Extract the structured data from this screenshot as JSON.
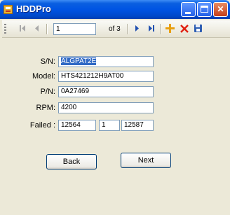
{
  "window": {
    "title": "HDDPro",
    "controls": {
      "minimize": "minimize",
      "maximize": "maximize",
      "close": "✕"
    }
  },
  "navigator": {
    "first_icon": "move-first-icon",
    "prev_icon": "move-previous-icon",
    "position": "1",
    "count_label": "of 3",
    "next_icon": "move-next-icon",
    "last_icon": "move-last-icon",
    "add_icon": "add-new-icon",
    "delete_icon": "delete-icon",
    "save_icon": "save-icon"
  },
  "form": {
    "sn": {
      "label": "S/N:",
      "value": "ALGPAT2E",
      "selected": true
    },
    "model": {
      "label": "Model:",
      "value": "HTS421212H9AT00"
    },
    "pn": {
      "label": "P/N:",
      "value": "0A27469"
    },
    "rpm": {
      "label": "RPM:",
      "value": "4200"
    },
    "failed": {
      "label": "Failed :",
      "values": [
        "12564",
        "1",
        "12587"
      ]
    }
  },
  "buttons": {
    "back": "Back",
    "next": "Next"
  },
  "colors": {
    "titlebar": "#0054e3",
    "selection": "#316ac5",
    "window_bg": "#ece9d8"
  }
}
